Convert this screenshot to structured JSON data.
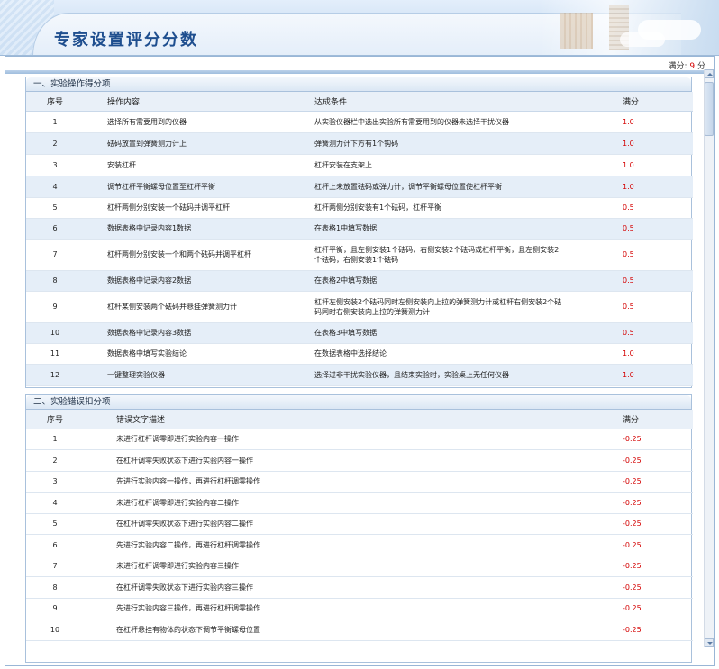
{
  "header": {
    "title": "专家设置评分分数"
  },
  "score": {
    "label": "满分:",
    "value": "9",
    "unit": "分"
  },
  "section1": {
    "title": "一、实验操作得分项",
    "columns": [
      "序号",
      "操作内容",
      "达成条件",
      "满分"
    ],
    "rows": [
      {
        "no": "1",
        "op": "选择所有需要用到的仪器",
        "cond": "从实验仪器栏中选出实验所有需要用到的仪器未选择干扰仪器",
        "score": "1.0"
      },
      {
        "no": "2",
        "op": "砝码放置到弹簧测力计上",
        "cond": "弹簧测力计下方有1个钩码",
        "score": "1.0"
      },
      {
        "no": "3",
        "op": "安装杠杆",
        "cond": "杠杆安装在支架上",
        "score": "1.0"
      },
      {
        "no": "4",
        "op": "调节杠杆平衡螺母位置至杠杆平衡",
        "cond": "杠杆上未放置砝码或弹力计，调节平衡螺母位置使杠杆平衡",
        "score": "1.0"
      },
      {
        "no": "5",
        "op": "杠杆两侧分别安装一个砝码并调平杠杆",
        "cond": "杠杆两侧分别安装有1个砝码，杠杆平衡",
        "score": "0.5"
      },
      {
        "no": "6",
        "op": "数据表格中记录内容1数据",
        "cond": "在表格1中填写数据",
        "score": "0.5"
      },
      {
        "no": "7",
        "op": "杠杆两侧分别安装一个和两个砝码并调平杠杆",
        "cond": "杠杆平衡，且左侧安装1个砝码，右侧安装2个砝码或杠杆平衡，且左侧安装2个砝码，右侧安装1个砝码",
        "score": "0.5"
      },
      {
        "no": "8",
        "op": "数据表格中记录内容2数据",
        "cond": "在表格2中填写数据",
        "score": "0.5"
      },
      {
        "no": "9",
        "op": "杠杆某侧安装两个砝码并悬挂弹簧测力计",
        "cond": "杠杆左侧安装2个砝码同时左侧安装向上拉的弹簧测力计或杠杆右侧安装2个砝码同时右侧安装向上拉的弹簧测力计",
        "score": "0.5"
      },
      {
        "no": "10",
        "op": "数据表格中记录内容3数据",
        "cond": "在表格3中填写数据",
        "score": "0.5"
      },
      {
        "no": "11",
        "op": "数据表格中填写实验结论",
        "cond": "在数据表格中选择结论",
        "score": "1.0"
      },
      {
        "no": "12",
        "op": "一键整理实验仪器",
        "cond": "选择过非干扰实验仪器，且结束实验时，实验桌上无任何仪器",
        "score": "1.0"
      }
    ]
  },
  "section2": {
    "title": "二、实验错误扣分项",
    "columns": [
      "序号",
      "错误文字描述",
      "满分"
    ],
    "rows": [
      {
        "no": "1",
        "desc": "未进行杠杆调零即进行实验内容一操作",
        "score": "-0.25"
      },
      {
        "no": "2",
        "desc": "在杠杆调零失败状态下进行实验内容一操作",
        "score": "-0.25"
      },
      {
        "no": "3",
        "desc": "先进行实验内容一操作，再进行杠杆调零操作",
        "score": "-0.25"
      },
      {
        "no": "4",
        "desc": "未进行杠杆调零即进行实验内容二操作",
        "score": "-0.25"
      },
      {
        "no": "5",
        "desc": "在杠杆调零失败状态下进行实验内容二操作",
        "score": "-0.25"
      },
      {
        "no": "6",
        "desc": "先进行实验内容二操作，再进行杠杆调零操作",
        "score": "-0.25"
      },
      {
        "no": "7",
        "desc": "未进行杠杆调零即进行实验内容三操作",
        "score": "-0.25"
      },
      {
        "no": "8",
        "desc": "在杠杆调零失败状态下进行实验内容三操作",
        "score": "-0.25"
      },
      {
        "no": "9",
        "desc": "先进行实验内容三操作，再进行杠杆调零操作",
        "score": "-0.25"
      },
      {
        "no": "10",
        "desc": "在杠杆悬挂有物体的状态下调节平衡螺母位置",
        "score": "-0.25"
      }
    ]
  }
}
